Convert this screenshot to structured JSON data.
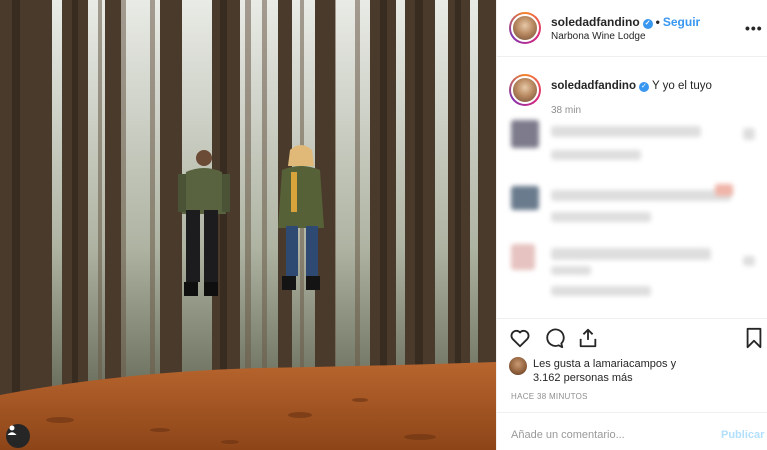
{
  "post": {
    "author": "soledadfandino",
    "follow_label": "Seguir",
    "location": "Narbona Wine Lodge",
    "more_label": "•••"
  },
  "caption": {
    "author": "soledadfandino",
    "text": "Y yo el tuyo",
    "time": "38 min"
  },
  "likes": {
    "line1": "Les gusta a lamariacampos y",
    "line2": "3.162 personas más"
  },
  "post_time": "HACE 38 MINUTOS",
  "comment_box": {
    "placeholder": "Añade un comentario...",
    "publish_label": "Publicar"
  },
  "icons": {
    "like": "heart-icon",
    "comment": "speech-bubble-icon",
    "share": "share-icon",
    "save": "bookmark-icon",
    "tag": "user-tag-icon"
  },
  "colors": {
    "accent": "#3897f0",
    "verified": "#3897f0",
    "publish_disabled": "#b2dffc"
  }
}
